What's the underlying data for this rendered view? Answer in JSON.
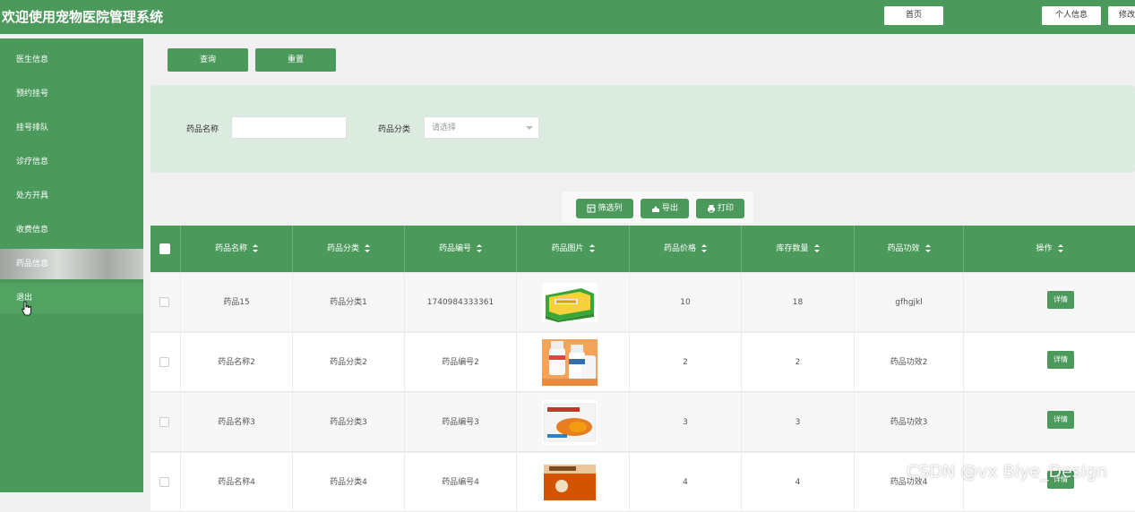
{
  "header": {
    "title": "欢迎使用宠物医院管理系统",
    "home_label": "首页",
    "profile_label": "个人信息",
    "modify_label": "修改"
  },
  "sidebar": {
    "items": [
      {
        "label": "医生信息"
      },
      {
        "label": "预约挂号"
      },
      {
        "label": "挂号排队"
      },
      {
        "label": "诊疗信息"
      },
      {
        "label": "处方开具"
      },
      {
        "label": "收费信息"
      },
      {
        "label": "药品信息"
      },
      {
        "label": "退出"
      }
    ]
  },
  "toolbar": {
    "query_label": "查询",
    "reset_label": "重置"
  },
  "search": {
    "name_label": "药品名称",
    "name_value": "",
    "category_label": "药品分类",
    "category_placeholder": "请选择"
  },
  "actions": {
    "filter_label": "筛选列",
    "export_label": "导出",
    "print_label": "打印"
  },
  "table": {
    "columns": [
      "药品名称",
      "药品分类",
      "药品编号",
      "药品图片",
      "药品价格",
      "库存数量",
      "药品功效",
      "操作"
    ],
    "detail_label": "详情",
    "rows": [
      {
        "name": "药品15",
        "category": "药品分类1",
        "code": "1740984333361",
        "price": "10",
        "stock": "18",
        "effect": "gfhgjkl"
      },
      {
        "name": "药品名称2",
        "category": "药品分类2",
        "code": "药品编号2",
        "price": "2",
        "stock": "2",
        "effect": "药品功效2"
      },
      {
        "name": "药品名称3",
        "category": "药品分类3",
        "code": "药品编号3",
        "price": "3",
        "stock": "3",
        "effect": "药品功效3"
      },
      {
        "name": "药品名称4",
        "category": "药品分类4",
        "code": "药品编号4",
        "price": "4",
        "stock": "4",
        "effect": "药品功效4"
      }
    ]
  },
  "watermark": "CSDN @vx Biye_Design",
  "colors": {
    "primary": "#4b9a5c",
    "panel": "#dcebe0"
  }
}
